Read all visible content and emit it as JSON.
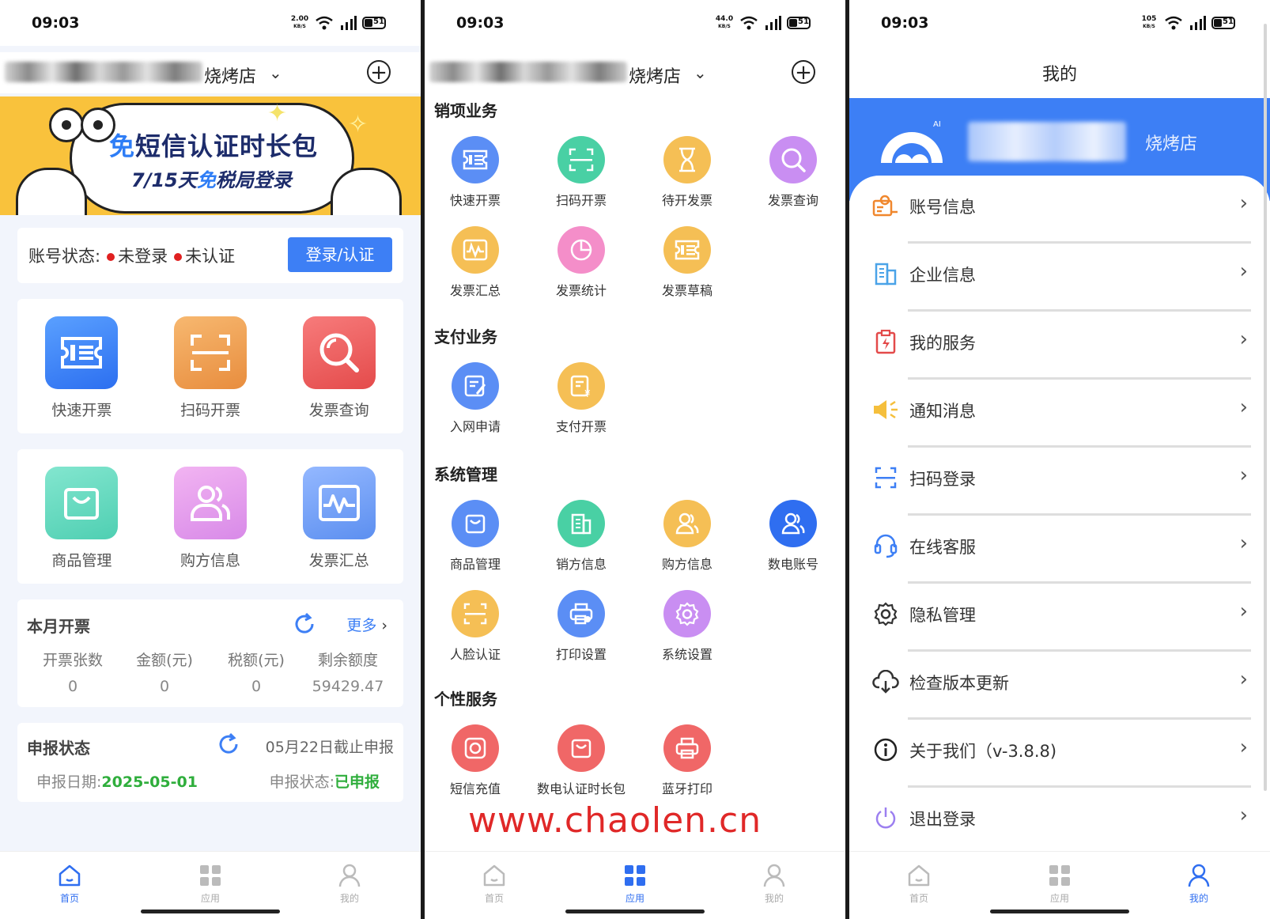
{
  "status": {
    "time": "09:03",
    "speed1": "2.00",
    "speed2": "44.0",
    "speed3": "105",
    "speed_unit": "KB/S",
    "battery": "51"
  },
  "shop": {
    "suffix": "烧烤店"
  },
  "home": {
    "banner": {
      "line1_free": "免",
      "line1_rest": "短信认证时长包",
      "line2_a": "7/15天",
      "line2_free": "免",
      "line2_b": "税局登录"
    },
    "account": {
      "label": "账号状态:",
      "status1": "未登录",
      "status2": "未认证",
      "button": "登录/认证"
    },
    "grid1": [
      {
        "label": "快速开票",
        "icon": "invoice-icon"
      },
      {
        "label": "扫码开票",
        "icon": "scan-icon"
      },
      {
        "label": "发票查询",
        "icon": "search-icon"
      }
    ],
    "grid2": [
      {
        "label": "商品管理",
        "icon": "bag-icon"
      },
      {
        "label": "购方信息",
        "icon": "users-icon"
      },
      {
        "label": "发票汇总",
        "icon": "pulse-icon"
      }
    ],
    "month": {
      "title": "本月开票",
      "more": "更多",
      "stats": [
        {
          "label": "开票张数",
          "value": "0"
        },
        {
          "label": "金额(元)",
          "value": "0"
        },
        {
          "label": "税额(元)",
          "value": "0"
        },
        {
          "label": "剩余额度",
          "value": "59429.47"
        }
      ]
    },
    "declare": {
      "title": "申报状态",
      "deadline": "05月22日截止申报",
      "date_label": "申报日期:",
      "date": "2025-05-01",
      "status_label": "申报状态:",
      "status": "已申报"
    }
  },
  "tabs": [
    {
      "label": "首页"
    },
    {
      "label": "应用"
    },
    {
      "label": "我的"
    }
  ],
  "apps": {
    "sections": [
      {
        "title": "销项业务",
        "items": [
          {
            "label": "快速开票"
          },
          {
            "label": "扫码开票"
          },
          {
            "label": "待开发票"
          },
          {
            "label": "发票查询"
          },
          {
            "label": "发票汇总"
          },
          {
            "label": "发票统计"
          },
          {
            "label": "发票草稿"
          }
        ]
      },
      {
        "title": "支付业务",
        "items": [
          {
            "label": "入网申请"
          },
          {
            "label": "支付开票"
          }
        ]
      },
      {
        "title": "系统管理",
        "items": [
          {
            "label": "商品管理"
          },
          {
            "label": "销方信息"
          },
          {
            "label": "购方信息"
          },
          {
            "label": "数电账号"
          },
          {
            "label": "人脸认证"
          },
          {
            "label": "打印设置"
          },
          {
            "label": "系统设置"
          }
        ]
      },
      {
        "title": "个性服务",
        "items": [
          {
            "label": "短信充值"
          },
          {
            "label": "数电认证时长包"
          },
          {
            "label": "蓝牙打印"
          }
        ]
      }
    ],
    "watermark": "www.chaolen.cn"
  },
  "mine": {
    "title": "我的",
    "logo_badge": "AI",
    "shop_suffix": "烧烤店",
    "menu": [
      {
        "label": "账号信息"
      },
      {
        "label": "企业信息"
      },
      {
        "label": "我的服务"
      },
      {
        "label": "通知消息"
      },
      {
        "label": "扫码登录"
      },
      {
        "label": "在线客服"
      },
      {
        "label": "隐私管理"
      },
      {
        "label": "检查版本更新"
      },
      {
        "label": "关于我们（v-3.8.8)"
      },
      {
        "label": "退出登录"
      }
    ]
  },
  "colors": {
    "primary": "#3d7ff5",
    "green": "#2fae3c",
    "red": "#e02020",
    "banner": "#f9c23c"
  }
}
